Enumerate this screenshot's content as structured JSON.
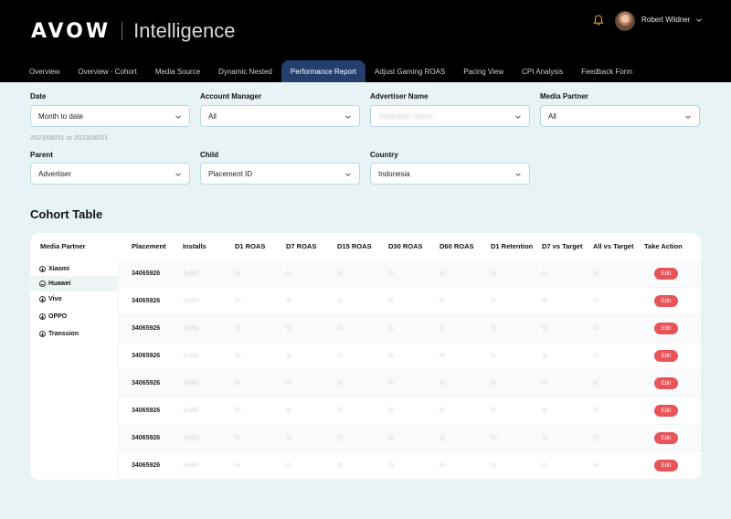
{
  "header": {
    "brand": "AVOW",
    "product": "Intelligence",
    "user_name": "Robert Wildner",
    "icons": {
      "notification": "bell-icon",
      "user_menu": "chevron-down-icon"
    }
  },
  "nav": {
    "tabs": [
      {
        "label": "Overview",
        "active": false
      },
      {
        "label": "Overview - Cohort",
        "active": false
      },
      {
        "label": "Media Source",
        "active": false
      },
      {
        "label": "Dynamic Nested",
        "active": false
      },
      {
        "label": "Performance Report",
        "active": true
      },
      {
        "label": "Adjust Gaming ROAS",
        "active": false
      },
      {
        "label": "Pacing View",
        "active": false
      },
      {
        "label": "CPI Analysis",
        "active": false
      },
      {
        "label": "Feedback Form",
        "active": false
      }
    ]
  },
  "filters": {
    "date": {
      "label": "Date",
      "value": "Month to date",
      "range": "2023/08/01 to 2023/08/21"
    },
    "account_manager": {
      "label": "Account Manager",
      "value": "All"
    },
    "advertiser_name": {
      "label": "Advertiser Name",
      "value": "Advertiser Name"
    },
    "media_partner": {
      "label": "Media Partner",
      "value": "All"
    },
    "parent": {
      "label": "Parent",
      "value": "Advertiser"
    },
    "child": {
      "label": "Child",
      "value": "Placement ID"
    },
    "country": {
      "label": "Country",
      "value": "Indonesia"
    }
  },
  "cohort": {
    "title": "Cohort Table",
    "columns": [
      "Media Partner",
      "Placement",
      "Installs",
      "D1 ROAS",
      "D7 ROAS",
      "D15 ROAS",
      "D30 ROAS",
      "D60 ROAS",
      "D1 Retention",
      "D7 vs Target",
      "All vs Target",
      "Take Action"
    ],
    "partners": [
      {
        "label": "Xiaomi",
        "expanded": false
      },
      {
        "label": "Huawei",
        "expanded": true
      },
      {
        "label": "Vivo",
        "expanded": false
      },
      {
        "label": "OPPO",
        "expanded": false
      },
      {
        "label": "Transsion",
        "expanded": false
      }
    ],
    "placeholder_installs": "4,450",
    "placeholder_metric": "%",
    "edit_label": "Edit",
    "rows": [
      {
        "placement": "34065926"
      },
      {
        "placement": "34065926"
      },
      {
        "placement": "34065926"
      },
      {
        "placement": "34065926"
      },
      {
        "placement": "34065926"
      },
      {
        "placement": "34065926"
      },
      {
        "placement": "34065926"
      },
      {
        "placement": "34065926"
      }
    ]
  }
}
